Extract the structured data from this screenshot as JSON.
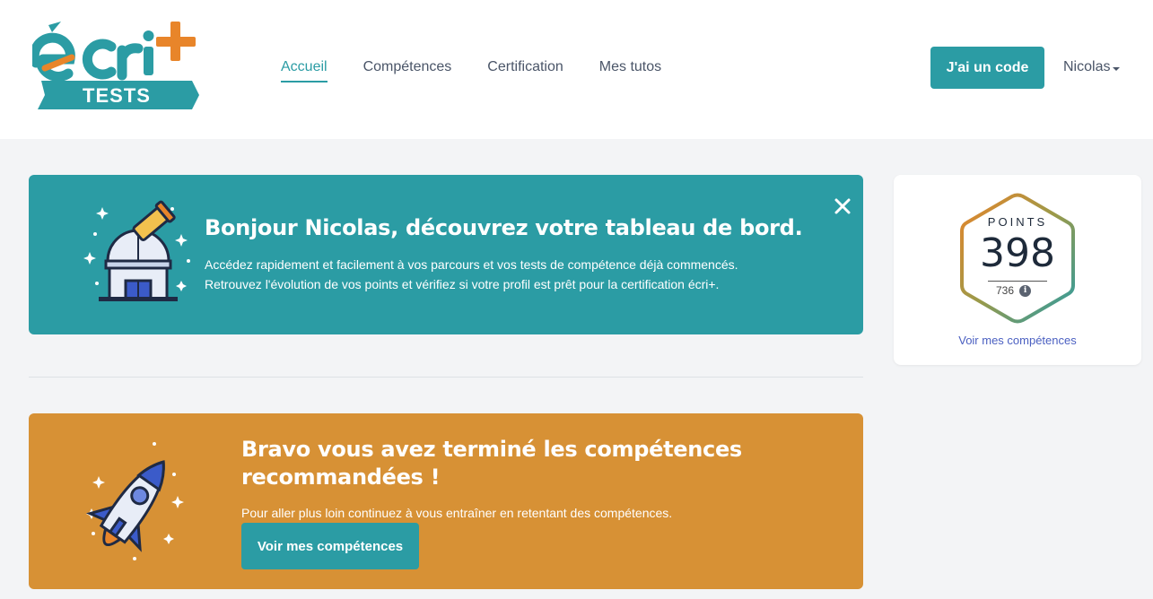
{
  "header": {
    "logo_text": "écri+",
    "logo_sub": "TESTS",
    "nav": [
      {
        "label": "Accueil",
        "active": true
      },
      {
        "label": "Compétences",
        "active": false
      },
      {
        "label": "Certification",
        "active": false
      },
      {
        "label": "Mes tutos",
        "active": false
      }
    ],
    "code_button": "J'ai un code",
    "user_name": "Nicolas"
  },
  "welcome": {
    "title": "Bonjour Nicolas, découvrez votre tableau de bord.",
    "line1": "Accédez rapidement et facilement à vos parcours et vos tests de compétence déjà commencés.",
    "line2": "Retrouvez l'évolution de vos points et vérifiez si votre profil est prêt pour la certification écri+.",
    "icon": "observatory-icon",
    "close_icon": "close-icon"
  },
  "bravo": {
    "title": "Bravo vous avez terminé les compétences recommandées !",
    "text": "Pour aller plus loin continuez à vous entraîner en retentant des compétences.",
    "button": "Voir mes compétences",
    "icon": "rocket-icon"
  },
  "points": {
    "label": "POINTS",
    "value": "398",
    "max": "736",
    "link": "Voir mes compétences"
  },
  "colors": {
    "teal": "#2b9ca4",
    "orange": "#d79135",
    "logo_orange": "#e8852a",
    "link": "#4a5fc1"
  }
}
